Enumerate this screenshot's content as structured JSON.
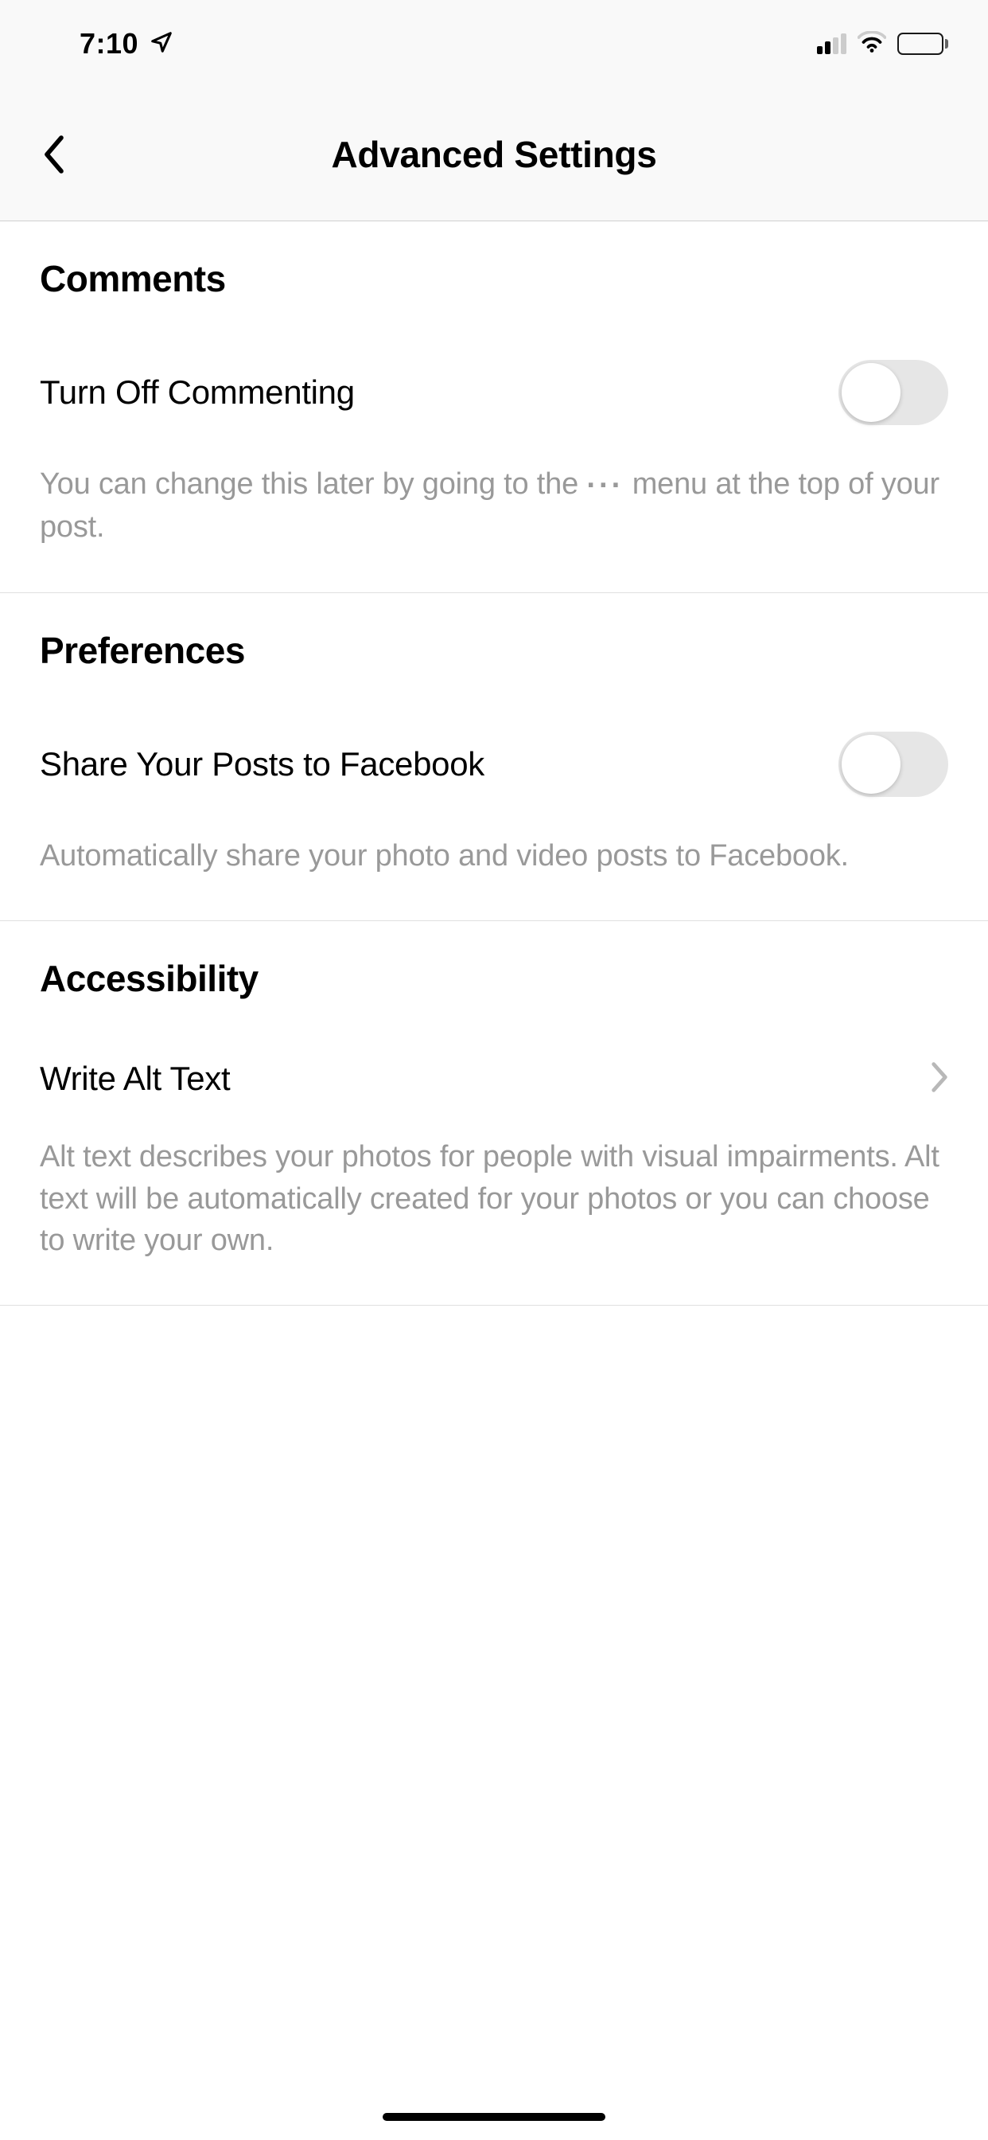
{
  "status_bar": {
    "time": "7:10"
  },
  "header": {
    "title": "Advanced Settings"
  },
  "sections": {
    "comments": {
      "header": "Comments",
      "toggle_label": "Turn Off Commenting",
      "toggle_on": false,
      "desc_before": "You can change this later by going to the ",
      "desc_dots": "···",
      "desc_after": " menu at the top of your post."
    },
    "preferences": {
      "header": "Preferences",
      "toggle_label": "Share Your Posts to Facebook",
      "toggle_on": false,
      "desc": "Automatically share your photo and video posts to Facebook."
    },
    "accessibility": {
      "header": "Accessibility",
      "nav_label": "Write Alt Text",
      "desc": "Alt text describes your photos for people with visual impairments. Alt text will be automatically created for your photos or you can choose to write your own."
    }
  }
}
